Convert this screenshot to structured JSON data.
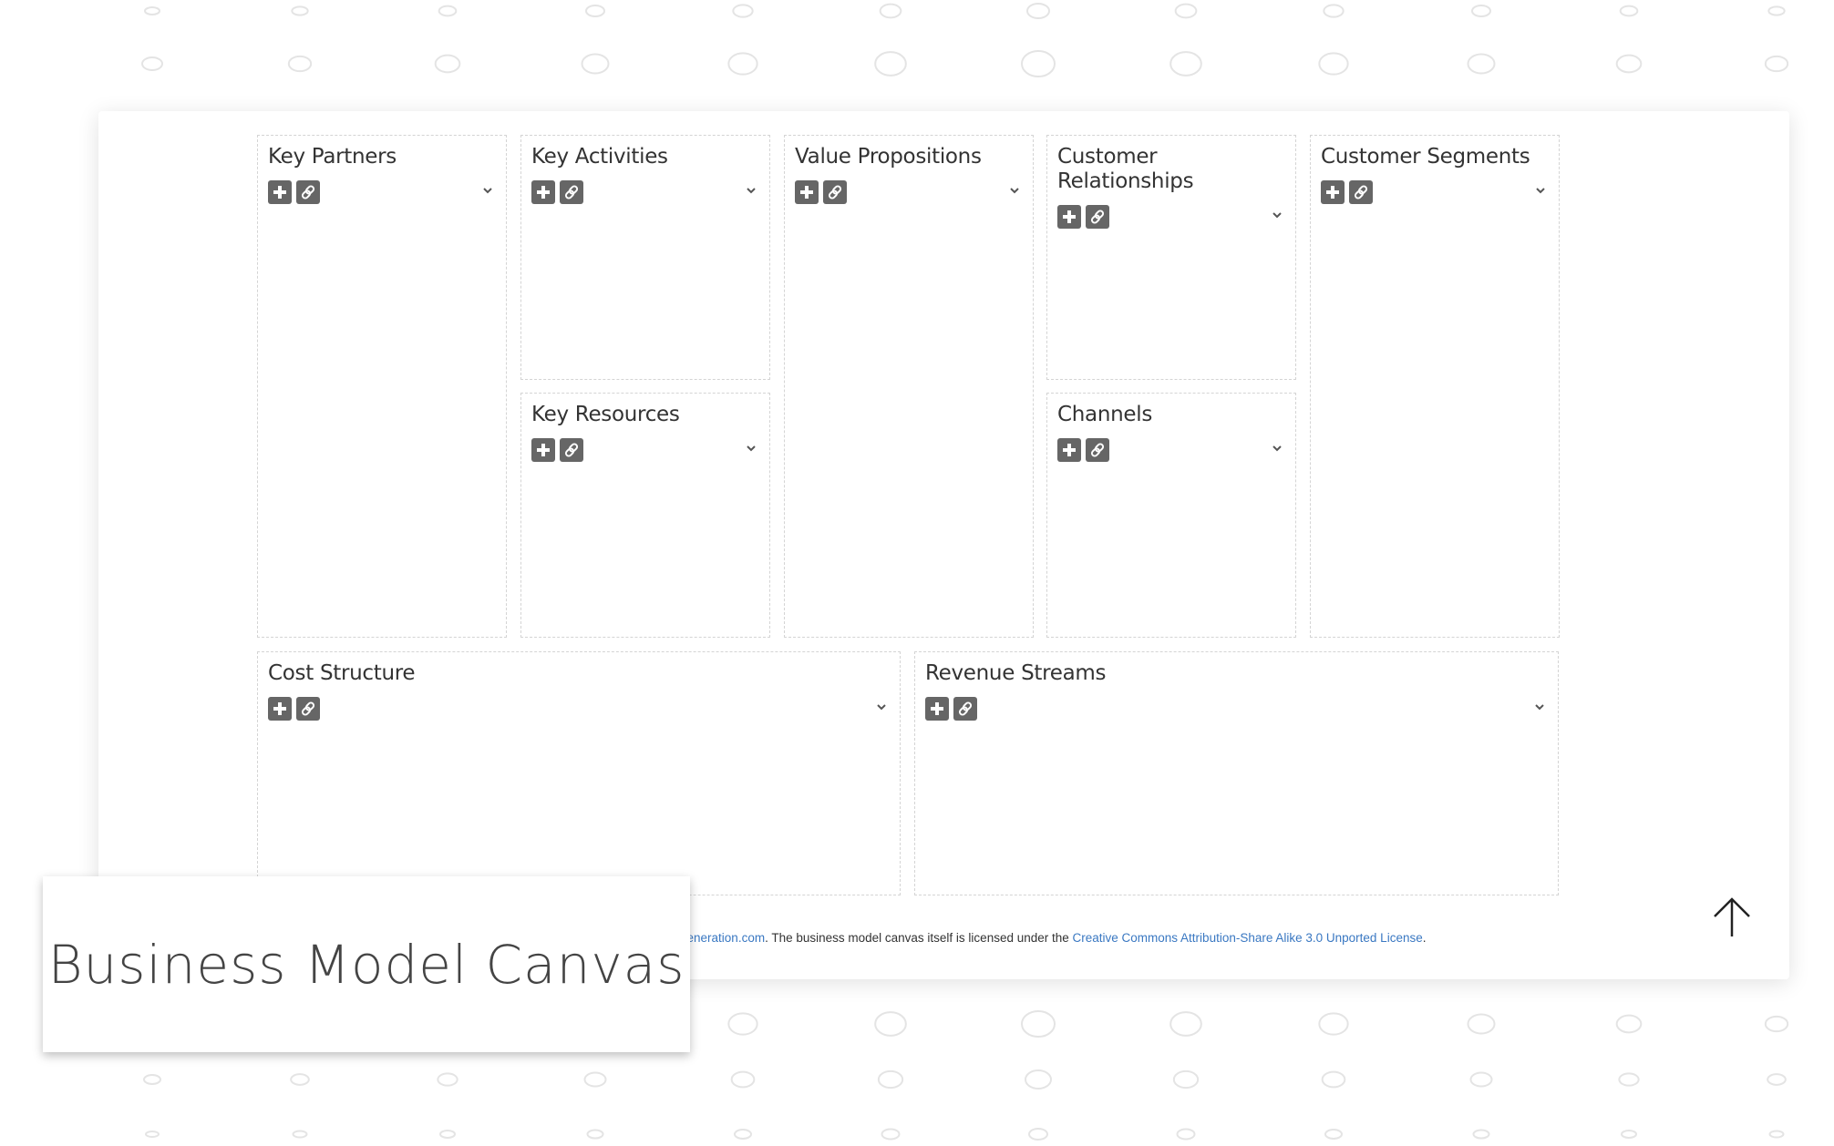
{
  "canvas": {
    "blocks": [
      {
        "id": "key-partners",
        "title": "Key Partners"
      },
      {
        "id": "key-activities",
        "title": "Key Activities"
      },
      {
        "id": "key-resources",
        "title": "Key Resources"
      },
      {
        "id": "value-propositions",
        "title": "Value Propositions"
      },
      {
        "id": "customer-relationships",
        "title": "Customer Relationships"
      },
      {
        "id": "channels",
        "title": "Channels"
      },
      {
        "id": "customer-segments",
        "title": "Customer Segments"
      },
      {
        "id": "cost-structure",
        "title": "Cost Structure"
      },
      {
        "id": "revenue-streams",
        "title": "Revenue Streams"
      }
    ],
    "icons": {
      "add": "plus-icon",
      "link": "link-icon",
      "expand": "chevron-down-icon"
    }
  },
  "footer": {
    "link1": "delgeneration.com",
    "text": ". The business model canvas itself is licensed under the ",
    "link2": "Creative Commons Attribution-Share Alike 3.0 Unported License",
    "end": "."
  },
  "overlay_title": "Business Model Canvas",
  "colors": {
    "link": "#3a78c2",
    "icon_bg": "#666666",
    "border": "#d4d4d4"
  }
}
